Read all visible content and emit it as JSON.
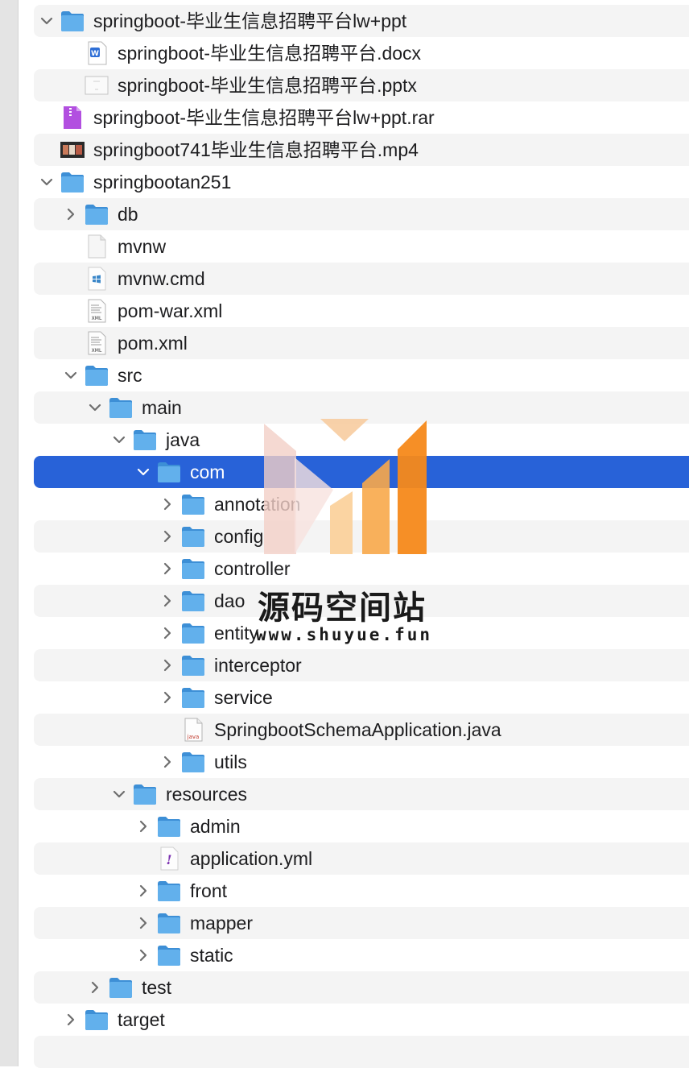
{
  "rows": [
    {
      "depth": 0,
      "expand": "open",
      "icon": "folder-icon",
      "label": "springboot-毕业生信息招聘平台lw+ppt"
    },
    {
      "depth": 1,
      "expand": "none",
      "icon": "word-doc-icon",
      "label": "springboot-毕业生信息招聘平台.docx"
    },
    {
      "depth": 1,
      "expand": "none",
      "icon": "pptx-file-icon",
      "label": "springboot-毕业生信息招聘平台.pptx"
    },
    {
      "depth": 0,
      "expand": "none",
      "icon": "rar-archive-icon",
      "label": "springboot-毕业生信息招聘平台lw+ppt.rar"
    },
    {
      "depth": 0,
      "expand": "none",
      "icon": "video-thumbnail-icon",
      "label": "springboot741毕业生信息招聘平台.mp4"
    },
    {
      "depth": 0,
      "expand": "open",
      "icon": "folder-icon",
      "label": "springbootan251"
    },
    {
      "depth": 1,
      "expand": "closed",
      "icon": "folder-icon",
      "label": "db"
    },
    {
      "depth": 1,
      "expand": "none",
      "icon": "blank-file-icon",
      "label": "mvnw"
    },
    {
      "depth": 1,
      "expand": "none",
      "icon": "cmd-file-icon",
      "label": "mvnw.cmd"
    },
    {
      "depth": 1,
      "expand": "none",
      "icon": "xml-file-icon",
      "label": "pom-war.xml"
    },
    {
      "depth": 1,
      "expand": "none",
      "icon": "xml-file-icon",
      "label": "pom.xml"
    },
    {
      "depth": 1,
      "expand": "open",
      "icon": "folder-icon",
      "label": "src"
    },
    {
      "depth": 2,
      "expand": "open",
      "icon": "folder-icon",
      "label": "main"
    },
    {
      "depth": 3,
      "expand": "open",
      "icon": "folder-icon",
      "label": "java"
    },
    {
      "depth": 4,
      "expand": "open",
      "icon": "folder-icon",
      "label": "com",
      "selected": true
    },
    {
      "depth": 5,
      "expand": "closed",
      "icon": "folder-icon",
      "label": "annotation"
    },
    {
      "depth": 5,
      "expand": "closed",
      "icon": "folder-icon",
      "label": "config"
    },
    {
      "depth": 5,
      "expand": "closed",
      "icon": "folder-icon",
      "label": "controller"
    },
    {
      "depth": 5,
      "expand": "closed",
      "icon": "folder-icon",
      "label": "dao"
    },
    {
      "depth": 5,
      "expand": "closed",
      "icon": "folder-icon",
      "label": "entity"
    },
    {
      "depth": 5,
      "expand": "closed",
      "icon": "folder-icon",
      "label": "interceptor"
    },
    {
      "depth": 5,
      "expand": "closed",
      "icon": "folder-icon",
      "label": "service"
    },
    {
      "depth": 5,
      "expand": "none",
      "icon": "java-file-icon",
      "label": "SpringbootSchemaApplication.java"
    },
    {
      "depth": 5,
      "expand": "closed",
      "icon": "folder-icon",
      "label": "utils"
    },
    {
      "depth": 3,
      "expand": "open",
      "icon": "folder-icon",
      "label": "resources"
    },
    {
      "depth": 4,
      "expand": "closed",
      "icon": "folder-icon",
      "label": "admin"
    },
    {
      "depth": 4,
      "expand": "none",
      "icon": "yml-file-icon",
      "label": "application.yml"
    },
    {
      "depth": 4,
      "expand": "closed",
      "icon": "folder-icon",
      "label": "front"
    },
    {
      "depth": 4,
      "expand": "closed",
      "icon": "folder-icon",
      "label": "mapper"
    },
    {
      "depth": 4,
      "expand": "closed",
      "icon": "folder-icon",
      "label": "static"
    },
    {
      "depth": 2,
      "expand": "closed",
      "icon": "folder-icon",
      "label": "test"
    },
    {
      "depth": 1,
      "expand": "closed",
      "icon": "folder-icon",
      "label": "target"
    },
    {
      "depth": 0,
      "expand": "none",
      "icon": "",
      "label": ""
    }
  ],
  "watermark": {
    "title": "源码空间站",
    "url": "www.shuyue.fun"
  },
  "colors": {
    "selection": "#2862d8",
    "folder": "#5aa9e6",
    "stripe": "#f4f4f4",
    "watermark_orange": "#f5891a"
  }
}
